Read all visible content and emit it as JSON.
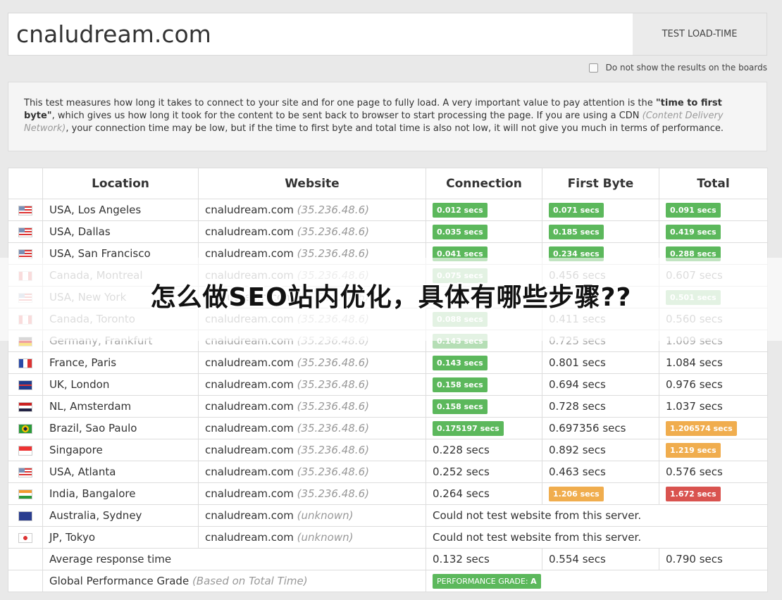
{
  "search": {
    "value": "cnaludream.com",
    "button": "TEST LOAD-TIME"
  },
  "option": {
    "label": "Do not show the results on the boards"
  },
  "description": {
    "part1": "This test measures how long it takes to connect to your site and for one page to fully load. A very important value to pay attention is the ",
    "bold": "\"time to first byte\"",
    "part2": ", which gives us how long it took for the content to be sent back to browser to start processing the page. If you are using a CDN ",
    "cdn": "(Content Delivery Network)",
    "part3": ", your connection time may be low, but if the time to first byte and total time is also not low, it will not give you much in terms of performance."
  },
  "table": {
    "headers": {
      "location": "Location",
      "website": "Website",
      "connection": "Connection",
      "first_byte": "First Byte",
      "total": "Total"
    },
    "rows": [
      {
        "flag": "us-flag-icon",
        "location": "USA, Los Angeles",
        "site": "cnaludream.com",
        "ip": "(35.236.48.6)",
        "conn": "0.012 secs",
        "conn_style": "green",
        "fb": "0.071 secs",
        "fb_style": "green",
        "total": "0.091 secs",
        "total_style": "green"
      },
      {
        "flag": "us-flag-icon",
        "location": "USA, Dallas",
        "site": "cnaludream.com",
        "ip": "(35.236.48.6)",
        "conn": "0.035 secs",
        "conn_style": "green",
        "fb": "0.185 secs",
        "fb_style": "green",
        "total": "0.419 secs",
        "total_style": "green"
      },
      {
        "flag": "us-flag-icon",
        "location": "USA, San Francisco",
        "site": "cnaludream.com",
        "ip": "(35.236.48.6)",
        "conn": "0.041 secs",
        "conn_style": "green",
        "fb": "0.234 secs",
        "fb_style": "green",
        "total": "0.288 secs",
        "total_style": "green"
      },
      {
        "flag": "ca-flag-icon",
        "location": "Canada, Montreal",
        "site": "cnaludream.com",
        "ip": "(35.236.48.6)",
        "conn": "0.075 secs",
        "conn_style": "green",
        "fb": "0.456 secs",
        "fb_style": "plain",
        "total": "0.607 secs",
        "total_style": "plain"
      },
      {
        "flag": "us-flag-icon",
        "location": "USA, New York",
        "site": "cnaludream.com",
        "ip": "(35.236.48.6)",
        "conn": "",
        "conn_style": "plain",
        "fb": "",
        "fb_style": "plain",
        "total": "0.501 secs",
        "total_style": "green"
      },
      {
        "flag": "ca-flag-icon",
        "location": "Canada, Toronto",
        "site": "cnaludream.com",
        "ip": "(35.236.48.6)",
        "conn": "0.088 secs",
        "conn_style": "green",
        "fb": "0.411 secs",
        "fb_style": "plain",
        "total": "0.560 secs",
        "total_style": "plain"
      },
      {
        "flag": "de-flag-icon",
        "location": "Germany, Frankfurt",
        "site": "cnaludream.com",
        "ip": "(35.236.48.6)",
        "conn": "0.143 secs",
        "conn_style": "green",
        "fb": "0.725 secs",
        "fb_style": "plain",
        "total": "1.009 secs",
        "total_style": "plain"
      },
      {
        "flag": "fr-flag-icon",
        "location": "France, Paris",
        "site": "cnaludream.com",
        "ip": "(35.236.48.6)",
        "conn": "0.143 secs",
        "conn_style": "green",
        "fb": "0.801 secs",
        "fb_style": "plain",
        "total": "1.084 secs",
        "total_style": "plain"
      },
      {
        "flag": "uk-flag-icon",
        "location": "UK, London",
        "site": "cnaludream.com",
        "ip": "(35.236.48.6)",
        "conn": "0.158 secs",
        "conn_style": "green",
        "fb": "0.694 secs",
        "fb_style": "plain",
        "total": "0.976 secs",
        "total_style": "plain"
      },
      {
        "flag": "nl-flag-icon",
        "location": "NL, Amsterdam",
        "site": "cnaludream.com",
        "ip": "(35.236.48.6)",
        "conn": "0.158 secs",
        "conn_style": "green",
        "fb": "0.728 secs",
        "fb_style": "plain",
        "total": "1.037 secs",
        "total_style": "plain"
      },
      {
        "flag": "br-flag-icon",
        "location": "Brazil, Sao Paulo",
        "site": "cnaludream.com",
        "ip": "(35.236.48.6)",
        "conn": "0.175197 secs",
        "conn_style": "green",
        "fb": "0.697356 secs",
        "fb_style": "plain",
        "total": "1.206574 secs",
        "total_style": "orange"
      },
      {
        "flag": "sg-flag-icon",
        "location": "Singapore",
        "site": "cnaludream.com",
        "ip": "(35.236.48.6)",
        "conn": "0.228 secs",
        "conn_style": "plain",
        "fb": "0.892 secs",
        "fb_style": "plain",
        "total": "1.219 secs",
        "total_style": "orange"
      },
      {
        "flag": "us-flag-icon",
        "location": "USA, Atlanta",
        "site": "cnaludream.com",
        "ip": "(35.236.48.6)",
        "conn": "0.252 secs",
        "conn_style": "plain",
        "fb": "0.463 secs",
        "fb_style": "plain",
        "total": "0.576 secs",
        "total_style": "plain"
      },
      {
        "flag": "in-flag-icon",
        "location": "India, Bangalore",
        "site": "cnaludream.com",
        "ip": "(35.236.48.6)",
        "conn": "0.264 secs",
        "conn_style": "plain",
        "fb": "1.206 secs",
        "fb_style": "orange",
        "total": "1.672 secs",
        "total_style": "red"
      }
    ],
    "error_rows": [
      {
        "flag": "au-flag-icon",
        "location": "Australia, Sydney",
        "site": "cnaludream.com",
        "ip": "(unknown)",
        "message": "Could not test website from this server."
      },
      {
        "flag": "jp-flag-icon",
        "location": "JP, Tokyo",
        "site": "cnaludream.com",
        "ip": "(unknown)",
        "message": "Could not test website from this server."
      }
    ],
    "average": {
      "label": "Average response time",
      "conn": "0.132 secs",
      "fb": "0.554 secs",
      "total": "0.790 secs"
    },
    "grade": {
      "label": "Global Performance Grade",
      "note": "(Based on Total Time)",
      "badge_label": "PERFORMANCE GRADE:",
      "badge_value": "A"
    }
  },
  "overlay": {
    "headline": "怎么做SEO站内优化，具体有哪些步骤??"
  },
  "colors": {
    "green": "#5cb85c",
    "orange": "#f0ad4e",
    "red": "#d9534f"
  }
}
